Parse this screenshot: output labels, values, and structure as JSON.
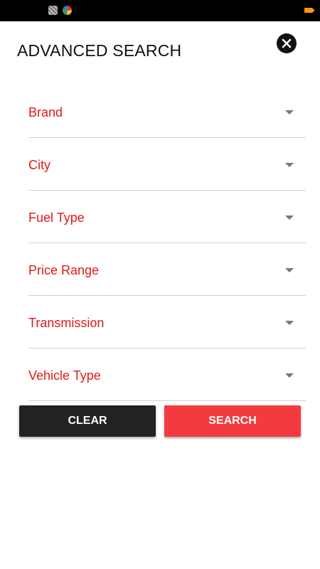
{
  "status_bar": {
    "icons": [
      "notification-image-icon",
      "chrome-icon",
      "battery-icon"
    ],
    "battery_color": "#ff9800"
  },
  "header": {
    "title": "ADVANCED SEARCH",
    "close_icon": "close-icon"
  },
  "fields": [
    {
      "label": "Brand"
    },
    {
      "label": "City"
    },
    {
      "label": "Fuel Type"
    },
    {
      "label": "Price Range"
    },
    {
      "label": "Transmission"
    },
    {
      "label": "Vehicle Type"
    }
  ],
  "actions": {
    "clear_label": "CLEAR",
    "search_label": "SEARCH"
  },
  "colors": {
    "accent": "#e01919",
    "search_button": "#f33b3f",
    "clear_button": "#222222"
  }
}
